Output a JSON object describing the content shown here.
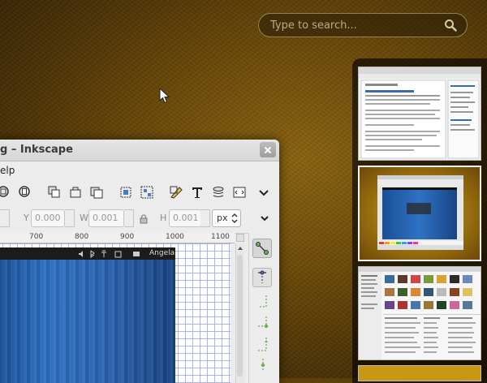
{
  "search": {
    "placeholder": "Type to search..."
  },
  "window": {
    "title": "g – Inkscape",
    "menu_label": "elp"
  },
  "toolbar2": {
    "y_label": "Y",
    "y_value": "0.000",
    "w_label": "W",
    "w_value": "0.001",
    "h_label": "H",
    "h_value": "0.001",
    "unit": "px"
  },
  "ruler": {
    "ticks": [
      "700",
      "800",
      "900",
      "1000",
      "1100"
    ]
  },
  "canvas": {
    "panel_user": "Angela"
  }
}
